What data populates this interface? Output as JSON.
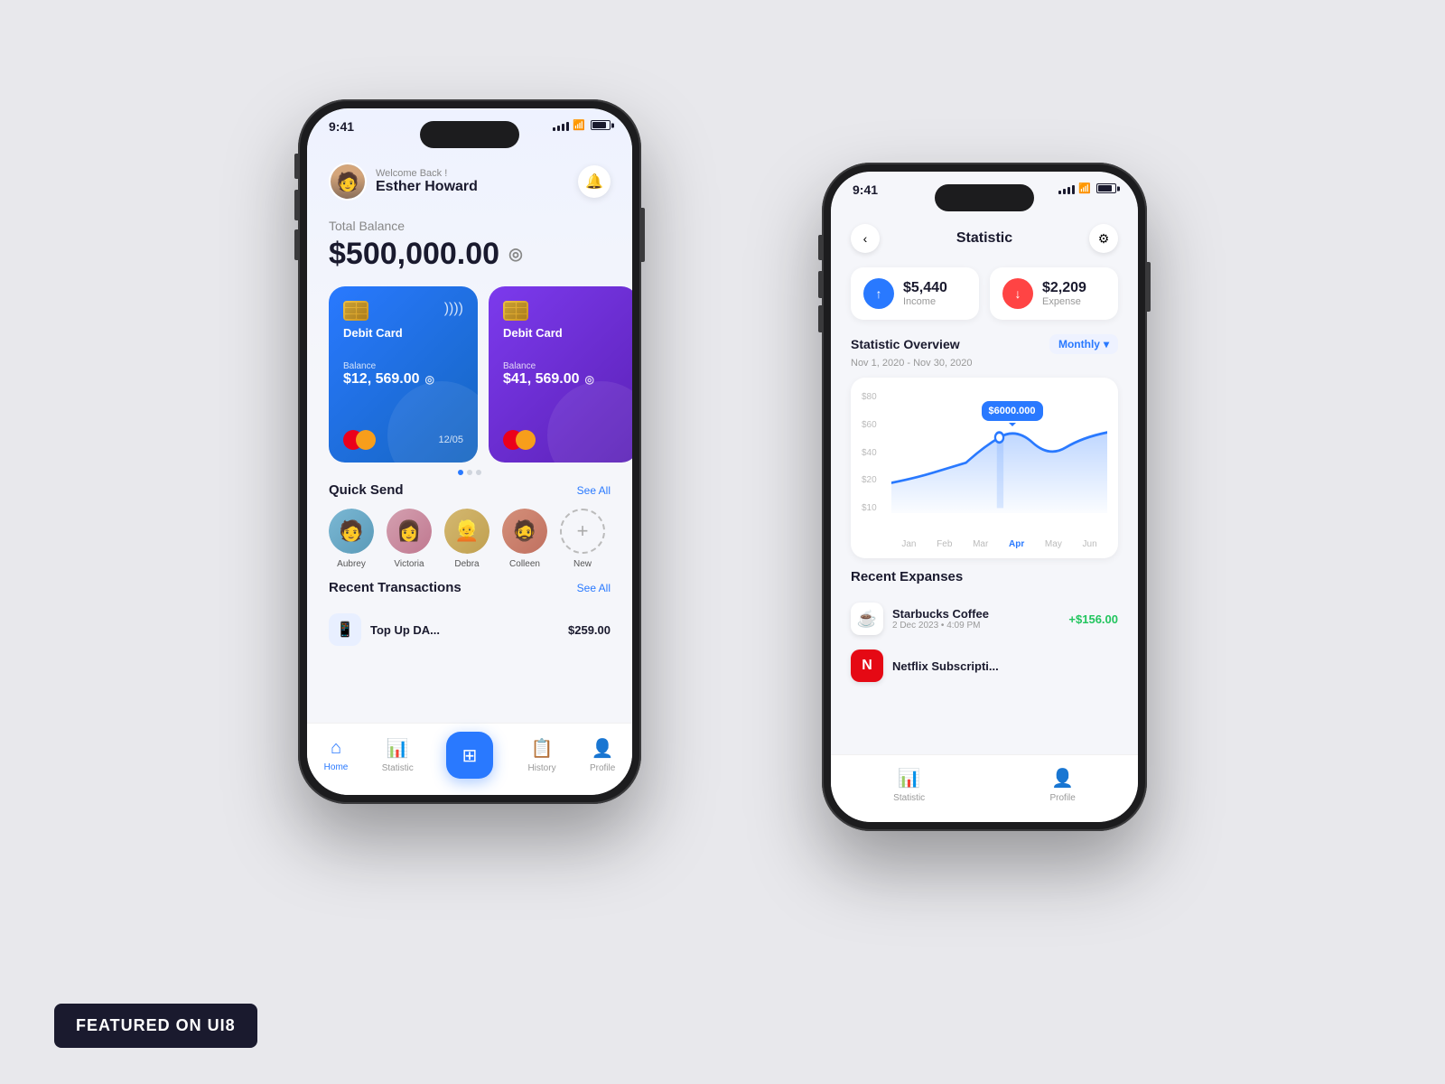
{
  "app": {
    "featured_label": "FEATURED ON UI8"
  },
  "left_phone": {
    "status_time": "9:41",
    "welcome_text": "Welcome Back !",
    "user_name": "Esther Howard",
    "total_balance_label": "Total Balance",
    "total_balance": "$500,000.00",
    "cards": [
      {
        "type": "Debit Card",
        "balance_label": "Balance",
        "balance": "$12, 569.00",
        "expiry": "12/05",
        "color": "blue"
      },
      {
        "type": "Debit Card",
        "balance_label": "Balance",
        "balance": "$41, 569.00",
        "color": "purple"
      }
    ],
    "quick_send_title": "Quick Send",
    "see_all": "See All",
    "contacts": [
      {
        "name": "Aubrey",
        "emoji": "👤"
      },
      {
        "name": "Victoria",
        "emoji": "👤"
      },
      {
        "name": "Debra",
        "emoji": "👤"
      },
      {
        "name": "Colleen",
        "emoji": "👤"
      },
      {
        "name": "New",
        "emoji": "+"
      }
    ],
    "recent_tx_title": "Recent Transactions",
    "recent_tx_see_all": "See All",
    "transactions": [
      {
        "name": "Top Up DA...",
        "amount": "$259.00"
      }
    ],
    "nav": [
      {
        "label": "Home",
        "active": true
      },
      {
        "label": "Statistic",
        "active": false
      },
      {
        "label": "",
        "active": false
      },
      {
        "label": "History",
        "active": false
      },
      {
        "label": "Profile",
        "active": false
      }
    ]
  },
  "right_phone": {
    "status_time": "9:41",
    "page_title": "Statistic",
    "income_amount": "$5,440",
    "income_label": "Income",
    "expense_amount": "$2,209",
    "expense_label": "Expense",
    "overview_title": "Statistic Overview",
    "monthly_label": "Monthly",
    "date_range": "Nov 1, 2020 - Nov 30, 2020",
    "chart_tooltip": "$6000.000",
    "chart_y_labels": [
      "$80",
      "$60",
      "$40",
      "$20",
      "$10"
    ],
    "chart_x_labels": [
      "Jan",
      "Feb",
      "Mar",
      "Apr",
      "May",
      "Jun"
    ],
    "active_month": "Apr",
    "recent_expenses_title": "Recent Expanses",
    "expenses": [
      {
        "name": "Starbucks Coffee",
        "date": "2 Dec 2023 • 4:09 PM",
        "amount": "+$156.00",
        "logo": "☕"
      },
      {
        "name": "Netflix Subscripti...",
        "date": "...",
        "amount": "",
        "logo": "N"
      }
    ],
    "nav": [
      {
        "label": "Statistic",
        "active": false
      },
      {
        "label": "Profile",
        "active": false
      }
    ]
  }
}
